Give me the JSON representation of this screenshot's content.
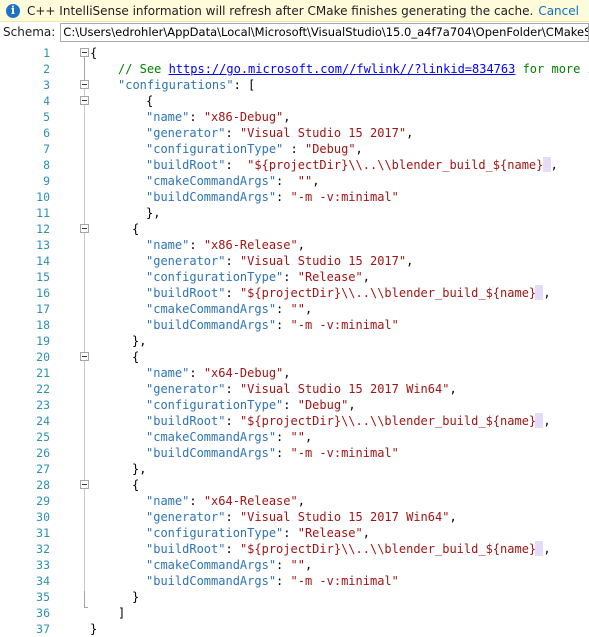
{
  "infobar": {
    "message": "C++ IntelliSense information will refresh after CMake finishes generating the cache.",
    "cancel_label": "Cancel"
  },
  "schema": {
    "label": "Schema:",
    "path": "C:\\Users\\edrohler\\AppData\\Local\\Microsoft\\VisualStudio\\15.0_a4f7a704\\OpenFolder\\CMakeSettings_"
  },
  "editor": {
    "lines": [
      {
        "num": "1",
        "fold": true,
        "indent": 0,
        "parts": [
          [
            "p",
            "{"
          ]
        ]
      },
      {
        "num": "2",
        "indent": 2,
        "parts": [
          [
            "c",
            "// See "
          ],
          [
            "u",
            "https://go.microsoft.com//fwlink//?linkid=834763"
          ],
          [
            "c",
            " for more inf"
          ]
        ]
      },
      {
        "num": "3",
        "fold": true,
        "indent": 2,
        "parts": [
          [
            "k",
            "\"configurations\""
          ],
          [
            "p",
            ": ["
          ]
        ]
      },
      {
        "num": "4",
        "fold": true,
        "indent": 4,
        "parts": [
          [
            "p",
            "{"
          ]
        ]
      },
      {
        "num": "5",
        "indent": 4,
        "parts": [
          [
            "k",
            "\"name\""
          ],
          [
            "p",
            ": "
          ],
          [
            "s",
            "\"x86-Debug\""
          ],
          [
            "p",
            ","
          ]
        ]
      },
      {
        "num": "6",
        "indent": 4,
        "parts": [
          [
            "k",
            "\"generator\""
          ],
          [
            "p",
            ": "
          ],
          [
            "s",
            "\"Visual Studio 15 2017\""
          ],
          [
            "p",
            ","
          ]
        ]
      },
      {
        "num": "7",
        "indent": 4,
        "parts": [
          [
            "k",
            "\"configurationType\""
          ],
          [
            "p",
            " : "
          ],
          [
            "s",
            "\"Debug\""
          ],
          [
            "p",
            ","
          ]
        ]
      },
      {
        "num": "8",
        "indent": 4,
        "parts": [
          [
            "k",
            "\"buildRoot\""
          ],
          [
            "p",
            ":  "
          ],
          [
            "s",
            "\"${projectDir}\\\\..\\\\blender_build_${name}\""
          ],
          [
            "h",
            ""
          ],
          [
            "p",
            ","
          ]
        ]
      },
      {
        "num": "9",
        "indent": 4,
        "parts": [
          [
            "k",
            "\"cmakeCommandArgs\""
          ],
          [
            "p",
            ":  "
          ],
          [
            "s",
            "\"\""
          ],
          [
            "p",
            ","
          ]
        ]
      },
      {
        "num": "10",
        "indent": 4,
        "parts": [
          [
            "k",
            "\"buildCommandArgs\""
          ],
          [
            "p",
            ": "
          ],
          [
            "s",
            "\"-m -v:minimal\""
          ]
        ]
      },
      {
        "num": "11",
        "indent": 4,
        "parts": [
          [
            "p",
            "},"
          ]
        ]
      },
      {
        "num": "12",
        "fold": true,
        "indent": 3,
        "parts": [
          [
            "p",
            "{"
          ]
        ]
      },
      {
        "num": "13",
        "indent": 4,
        "parts": [
          [
            "k",
            "\"name\""
          ],
          [
            "p",
            ": "
          ],
          [
            "s",
            "\"x86-Release\""
          ],
          [
            "p",
            ","
          ]
        ]
      },
      {
        "num": "14",
        "indent": 4,
        "parts": [
          [
            "k",
            "\"generator\""
          ],
          [
            "p",
            ": "
          ],
          [
            "s",
            "\"Visual Studio 15 2017\""
          ],
          [
            "p",
            ","
          ]
        ]
      },
      {
        "num": "15",
        "indent": 4,
        "parts": [
          [
            "k",
            "\"configurationType\""
          ],
          [
            "p",
            ": "
          ],
          [
            "s",
            "\"Release\""
          ],
          [
            "p",
            ","
          ]
        ]
      },
      {
        "num": "16",
        "indent": 4,
        "parts": [
          [
            "k",
            "\"buildRoot\""
          ],
          [
            "p",
            ": "
          ],
          [
            "s",
            "\"${projectDir}\\\\..\\\\blender_build_${name}\""
          ],
          [
            "h",
            ""
          ],
          [
            "p",
            ","
          ]
        ]
      },
      {
        "num": "17",
        "indent": 4,
        "parts": [
          [
            "k",
            "\"cmakeCommandArgs\""
          ],
          [
            "p",
            ": "
          ],
          [
            "s",
            "\"\""
          ],
          [
            "p",
            ","
          ]
        ]
      },
      {
        "num": "18",
        "indent": 4,
        "parts": [
          [
            "k",
            "\"buildCommandArgs\""
          ],
          [
            "p",
            ": "
          ],
          [
            "s",
            "\"-m -v:minimal\""
          ]
        ]
      },
      {
        "num": "19",
        "indent": 3,
        "parts": [
          [
            "p",
            "},"
          ]
        ]
      },
      {
        "num": "20",
        "fold": true,
        "indent": 3,
        "parts": [
          [
            "p",
            "{"
          ]
        ]
      },
      {
        "num": "21",
        "indent": 4,
        "parts": [
          [
            "k",
            "\"name\""
          ],
          [
            "p",
            ": "
          ],
          [
            "s",
            "\"x64-Debug\""
          ],
          [
            "p",
            ","
          ]
        ]
      },
      {
        "num": "22",
        "indent": 4,
        "parts": [
          [
            "k",
            "\"generator\""
          ],
          [
            "p",
            ": "
          ],
          [
            "s",
            "\"Visual Studio 15 2017 Win64\""
          ],
          [
            "p",
            ","
          ]
        ]
      },
      {
        "num": "23",
        "indent": 4,
        "parts": [
          [
            "k",
            "\"configurationType\""
          ],
          [
            "p",
            ": "
          ],
          [
            "s",
            "\"Debug\""
          ],
          [
            "p",
            ","
          ]
        ]
      },
      {
        "num": "24",
        "indent": 4,
        "parts": [
          [
            "k",
            "\"buildRoot\""
          ],
          [
            "p",
            ": "
          ],
          [
            "s",
            "\"${projectDir}\\\\..\\\\blender_build_${name}\""
          ],
          [
            "h",
            ""
          ],
          [
            "p",
            ","
          ]
        ]
      },
      {
        "num": "25",
        "indent": 4,
        "parts": [
          [
            "k",
            "\"cmakeCommandArgs\""
          ],
          [
            "p",
            ": "
          ],
          [
            "s",
            "\"\""
          ],
          [
            "p",
            ","
          ]
        ]
      },
      {
        "num": "26",
        "indent": 4,
        "parts": [
          [
            "k",
            "\"buildCommandArgs\""
          ],
          [
            "p",
            ": "
          ],
          [
            "s",
            "\"-m -v:minimal\""
          ]
        ]
      },
      {
        "num": "27",
        "indent": 3,
        "parts": [
          [
            "p",
            "},"
          ]
        ]
      },
      {
        "num": "28",
        "fold": true,
        "indent": 3,
        "parts": [
          [
            "p",
            "{"
          ]
        ]
      },
      {
        "num": "29",
        "indent": 4,
        "parts": [
          [
            "k",
            "\"name\""
          ],
          [
            "p",
            ": "
          ],
          [
            "s",
            "\"x64-Release\""
          ],
          [
            "p",
            ","
          ]
        ]
      },
      {
        "num": "30",
        "indent": 4,
        "parts": [
          [
            "k",
            "\"generator\""
          ],
          [
            "p",
            ": "
          ],
          [
            "s",
            "\"Visual Studio 15 2017 Win64\""
          ],
          [
            "p",
            ","
          ]
        ]
      },
      {
        "num": "31",
        "indent": 4,
        "parts": [
          [
            "k",
            "\"configurationType\""
          ],
          [
            "p",
            ": "
          ],
          [
            "s",
            "\"Release\""
          ],
          [
            "p",
            ","
          ]
        ]
      },
      {
        "num": "32",
        "indent": 4,
        "parts": [
          [
            "k",
            "\"buildRoot\""
          ],
          [
            "p",
            ": "
          ],
          [
            "s",
            "\"${projectDir}\\\\..\\\\blender_build_${name}\""
          ],
          [
            "h",
            ""
          ],
          [
            "p",
            ","
          ]
        ]
      },
      {
        "num": "33",
        "indent": 4,
        "parts": [
          [
            "k",
            "\"cmakeCommandArgs\""
          ],
          [
            "p",
            ": "
          ],
          [
            "s",
            "\"\""
          ],
          [
            "p",
            ","
          ]
        ]
      },
      {
        "num": "34",
        "indent": 4,
        "parts": [
          [
            "k",
            "\"buildCommandArgs\""
          ],
          [
            "p",
            ": "
          ],
          [
            "s",
            "\"-m -v:minimal\""
          ]
        ]
      },
      {
        "num": "35",
        "indent": 3,
        "parts": [
          [
            "p",
            "}"
          ]
        ]
      },
      {
        "num": "36",
        "indent": 2,
        "parts": [
          [
            "p",
            "]"
          ]
        ]
      },
      {
        "num": "37",
        "indent": 0,
        "parts": [
          [
            "p",
            "}"
          ]
        ]
      }
    ]
  }
}
